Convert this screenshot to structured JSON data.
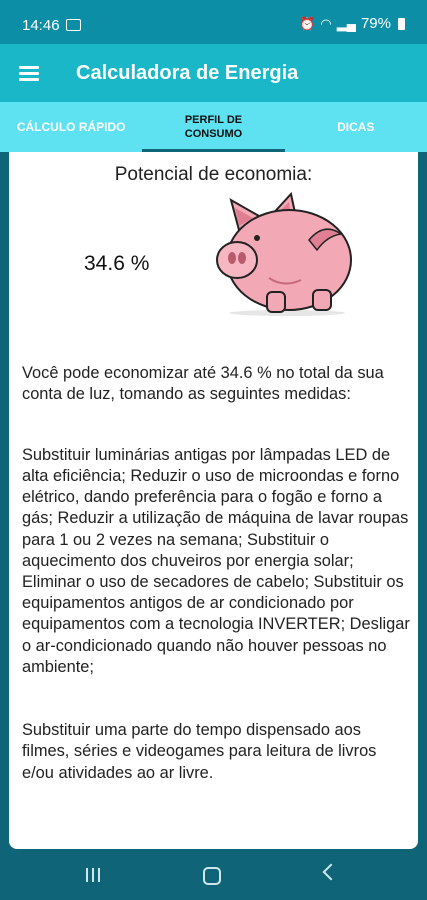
{
  "status": {
    "time": "14:46",
    "battery": "79%"
  },
  "app": {
    "title": "Calculadora de Energia"
  },
  "tabs": [
    {
      "label": "CÁLCULO RÁPIDO",
      "active": false
    },
    {
      "label": "PERFIL DE CONSUMO",
      "active": true
    },
    {
      "label": "DICAS",
      "active": false
    }
  ],
  "main": {
    "potential_label": "Potencial de economia:",
    "percent": "34.6 %",
    "intro": "Você pode economizar até 34.6 % no total da sua conta de luz, tomando as seguintes medidas:",
    "tips": "Substituir luminárias antigas por lâmpadas LED de alta eficiência; Reduzir o uso de microondas e forno elétrico, dando preferência para o fogão e forno a gás; Reduzir a utilização de máquina de lavar roupas para 1 ou 2 vezes na semana; Substituir o aquecimento dos chuveiros por energia solar; Eliminar o uso de secadores de cabelo; Substituir os equipamentos antigos de ar condicionado por equipamentos com a tecnologia INVERTER; Desligar o ar-condicionado quando não houver pessoas no ambiente;",
    "leisure": "Substituir uma parte do tempo dispensado aos filmes, séries e videogames para leitura de livros e/ou atividades ao ar livre."
  },
  "colors": {
    "status_bar": "#0c8fa6",
    "app_bar": "#1ab7c9",
    "tab_bar": "#5ee2f2",
    "nav_bar": "#0f6577",
    "piggy": "#f3a9b5"
  },
  "icons": {
    "menu": "hamburger-menu-icon",
    "piggy": "piggy-bank-icon",
    "nav": [
      "recents-icon",
      "home-icon",
      "back-icon"
    ]
  }
}
